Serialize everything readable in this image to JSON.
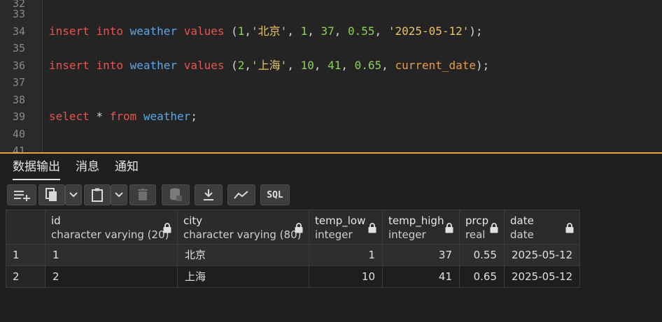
{
  "editor": {
    "lines": [
      {
        "n": "32",
        "tokens": []
      },
      {
        "n": "33",
        "tokens": []
      },
      {
        "n": "34",
        "tokens": [
          {
            "t": "insert",
            "c": "kw"
          },
          {
            "t": " ",
            "c": "pn"
          },
          {
            "t": "into",
            "c": "kw"
          },
          {
            "t": " ",
            "c": "pn"
          },
          {
            "t": "weather",
            "c": "id"
          },
          {
            "t": " ",
            "c": "pn"
          },
          {
            "t": "values",
            "c": "kw"
          },
          {
            "t": " (",
            "c": "pn"
          },
          {
            "t": "1",
            "c": "num"
          },
          {
            "t": ",",
            "c": "pn"
          },
          {
            "t": "'北京'",
            "c": "str"
          },
          {
            "t": ", ",
            "c": "pn"
          },
          {
            "t": "1",
            "c": "num"
          },
          {
            "t": ", ",
            "c": "pn"
          },
          {
            "t": "37",
            "c": "num"
          },
          {
            "t": ", ",
            "c": "pn"
          },
          {
            "t": "0.55",
            "c": "num"
          },
          {
            "t": ", ",
            "c": "pn"
          },
          {
            "t": "'2025-05-12'",
            "c": "str"
          },
          {
            "t": ");",
            "c": "pn"
          }
        ]
      },
      {
        "n": "35",
        "tokens": []
      },
      {
        "n": "36",
        "tokens": [
          {
            "t": "insert",
            "c": "kw"
          },
          {
            "t": " ",
            "c": "pn"
          },
          {
            "t": "into",
            "c": "kw"
          },
          {
            "t": " ",
            "c": "pn"
          },
          {
            "t": "weather",
            "c": "id"
          },
          {
            "t": " ",
            "c": "pn"
          },
          {
            "t": "values",
            "c": "kw"
          },
          {
            "t": " (",
            "c": "pn"
          },
          {
            "t": "2",
            "c": "num"
          },
          {
            "t": ",",
            "c": "pn"
          },
          {
            "t": "'上海'",
            "c": "str"
          },
          {
            "t": ", ",
            "c": "pn"
          },
          {
            "t": "10",
            "c": "num"
          },
          {
            "t": ", ",
            "c": "pn"
          },
          {
            "t": "41",
            "c": "num"
          },
          {
            "t": ", ",
            "c": "pn"
          },
          {
            "t": "0.65",
            "c": "num"
          },
          {
            "t": ", ",
            "c": "pn"
          },
          {
            "t": "current_date",
            "c": "fn"
          },
          {
            "t": ");",
            "c": "pn"
          }
        ]
      },
      {
        "n": "37",
        "tokens": []
      },
      {
        "n": "38",
        "tokens": []
      },
      {
        "n": "39",
        "tokens": [
          {
            "t": "select",
            "c": "kw"
          },
          {
            "t": " * ",
            "c": "pn"
          },
          {
            "t": "from",
            "c": "kw"
          },
          {
            "t": " ",
            "c": "pn"
          },
          {
            "t": "weather",
            "c": "id"
          },
          {
            "t": ";",
            "c": "pn"
          }
        ]
      },
      {
        "n": "40",
        "tokens": []
      },
      {
        "n": "41",
        "tokens": []
      }
    ]
  },
  "tabs": [
    "数据输出",
    "消息",
    "通知"
  ],
  "toolbar": {
    "buttons": [
      {
        "name": "add-row-button",
        "icon": "add-row-icon"
      },
      {
        "name": "copy-button",
        "icon": "copy-icon"
      },
      {
        "name": "copy-options-dropdown",
        "icon": "chevron-down-icon"
      },
      {
        "name": "paste-button",
        "icon": "paste-icon"
      },
      {
        "name": "paste-options-dropdown",
        "icon": "chevron-down-icon"
      },
      {
        "name": "delete-button",
        "icon": "trash-icon"
      },
      {
        "name": "save-data-button",
        "icon": "database-save-icon"
      },
      {
        "name": "download-button",
        "icon": "download-icon"
      },
      {
        "name": "graph-visualiser-button",
        "icon": "line-chart-icon"
      }
    ],
    "sql_label": "SQL"
  },
  "grid": {
    "columns": [
      {
        "name": "id",
        "type": "character varying (20)"
      },
      {
        "name": "city",
        "type": "character varying (80)"
      },
      {
        "name": "temp_low",
        "type": "integer"
      },
      {
        "name": "temp_high",
        "type": "integer"
      },
      {
        "name": "prcp",
        "type": "real"
      },
      {
        "name": "date",
        "type": "date"
      }
    ],
    "rows": [
      {
        "n": "1",
        "cells": [
          "1",
          "北京",
          "1",
          "37",
          "0.55",
          "2025-05-12"
        ]
      },
      {
        "n": "2",
        "cells": [
          "2",
          "上海",
          "10",
          "41",
          "0.65",
          "2025-05-12"
        ]
      }
    ]
  }
}
